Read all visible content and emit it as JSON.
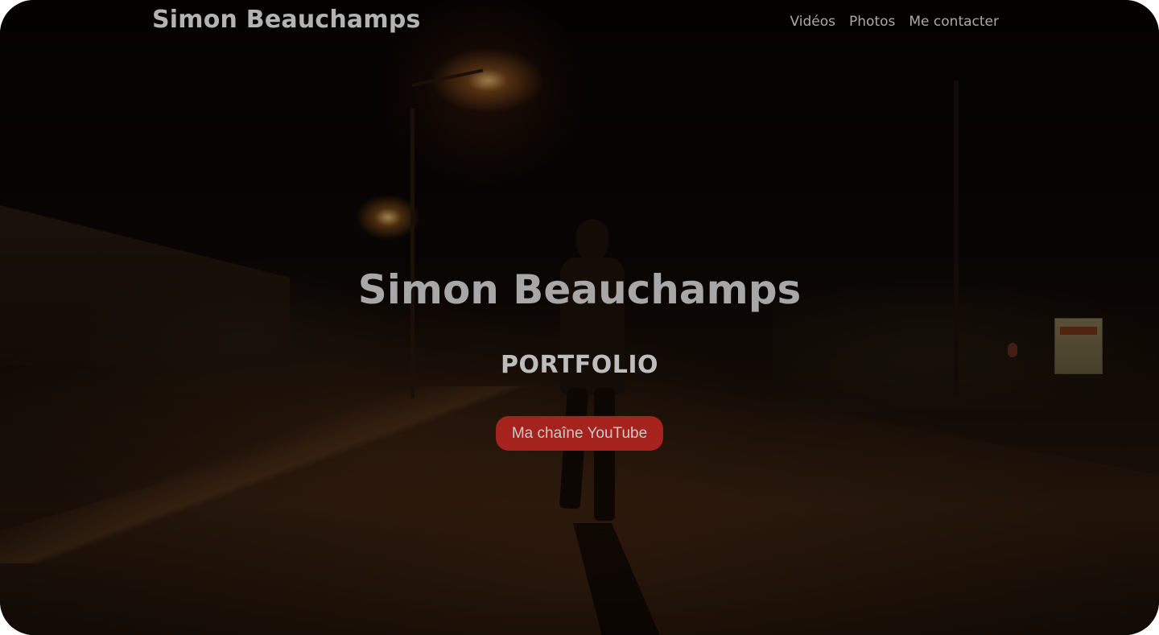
{
  "nav": {
    "brand": "Simon Beauchamps",
    "links": [
      {
        "label": "Vidéos"
      },
      {
        "label": "Photos"
      },
      {
        "label": "Me contacter"
      }
    ]
  },
  "hero": {
    "title": "Simon Beauchamps",
    "subtitle": "PORTFOLIO",
    "cta_label": "Ma chaîne YouTube"
  },
  "colors": {
    "cta_background": "#a6221c",
    "text": "#a7a7a7",
    "background": "#0b0704"
  }
}
